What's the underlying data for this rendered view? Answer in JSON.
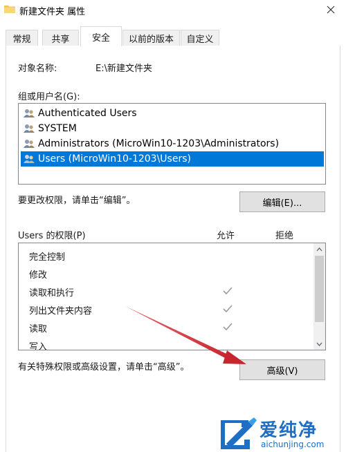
{
  "window": {
    "title": "新建文件夹 属性",
    "close_glyph": "✕"
  },
  "tabs": [
    {
      "label": "常规"
    },
    {
      "label": "共享"
    },
    {
      "label": "安全",
      "active": true
    },
    {
      "label": "以前的版本"
    },
    {
      "label": "自定义"
    }
  ],
  "object": {
    "label": "对象名称:",
    "value": "E:\\新建文件夹"
  },
  "groups": {
    "label": "组或用户名(G):",
    "items": [
      {
        "name": "Authenticated Users",
        "icon": "users-icon"
      },
      {
        "name": "SYSTEM",
        "icon": "users-icon"
      },
      {
        "name": "Administrators (MicroWin10-1203\\Administrators)",
        "icon": "users-icon"
      },
      {
        "name": "Users (MicroWin10-1203\\Users)",
        "icon": "users-icon",
        "selected": true
      }
    ]
  },
  "edit": {
    "hint": "要更改权限，请单击“编辑”。",
    "button": "编辑(E)..."
  },
  "permissions": {
    "title": "Users 的权限(P)",
    "allow_header": "允许",
    "deny_header": "拒绝",
    "rows": [
      {
        "name": "完全控制",
        "allow": false
      },
      {
        "name": "修改",
        "allow": false
      },
      {
        "name": "读取和执行",
        "allow": true
      },
      {
        "name": "列出文件夹内容",
        "allow": true
      },
      {
        "name": "读取",
        "allow": true
      },
      {
        "name": "写入",
        "allow": false
      }
    ]
  },
  "advanced": {
    "hint": "有关特殊权限或高级设置，请单击“高级”。",
    "button": "高级(V)"
  },
  "watermark": {
    "brand": "爱纯净",
    "url": "aichunjing.com"
  },
  "colors": {
    "selection": "#0078d7",
    "arrow": "#d9363e",
    "watermark_blue": "#1e6fc4"
  }
}
